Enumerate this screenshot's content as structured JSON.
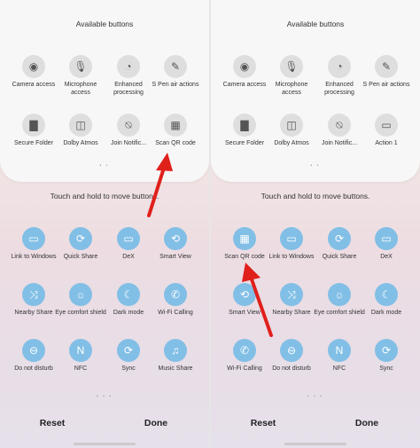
{
  "left": {
    "available_title": "Available buttons",
    "available": [
      {
        "label": "Camera access",
        "icon": "camera-icon",
        "glyph": "◉"
      },
      {
        "label": "Microphone access",
        "icon": "microphone-icon",
        "glyph": "🎙"
      },
      {
        "label": "Enhanced processing",
        "icon": "gauge-icon",
        "glyph": "◔"
      },
      {
        "label": "S Pen air actions",
        "icon": "pen-icon",
        "glyph": "✎"
      },
      {
        "label": "Secure Folder",
        "icon": "folder-icon",
        "glyph": "▇"
      },
      {
        "label": "Dolby Atmos",
        "icon": "dolby-icon",
        "glyph": "◫"
      },
      {
        "label": "Join Notific...",
        "icon": "notification-off-icon",
        "glyph": "⍉"
      },
      {
        "label": "Scan QR code",
        "icon": "qr-code-icon",
        "glyph": "▦"
      }
    ],
    "hint": "Touch and hold to move buttons.",
    "active": [
      {
        "label": "Link to Windows",
        "icon": "link-to-windows-icon",
        "glyph": "▭"
      },
      {
        "label": "Quick Share",
        "icon": "quick-share-icon",
        "glyph": "⟳"
      },
      {
        "label": "DeX",
        "icon": "dex-icon",
        "glyph": "▭"
      },
      {
        "label": "Smart View",
        "icon": "smart-view-icon",
        "glyph": "⟲"
      },
      {
        "label": "Nearby Share",
        "icon": "nearby-share-icon",
        "glyph": "⤨"
      },
      {
        "label": "Eye comfort shield",
        "icon": "eye-comfort-icon",
        "glyph": "☼"
      },
      {
        "label": "Dark mode",
        "icon": "moon-icon",
        "glyph": "☾"
      },
      {
        "label": "Wi-Fi Calling",
        "icon": "wifi-calling-icon",
        "glyph": "✆"
      },
      {
        "label": "Do not disturb",
        "icon": "do-not-disturb-icon",
        "glyph": "⊖"
      },
      {
        "label": "NFC",
        "icon": "nfc-icon",
        "glyph": "N"
      },
      {
        "label": "Sync",
        "icon": "sync-icon",
        "glyph": "⟳"
      },
      {
        "label": "Music Share",
        "icon": "music-share-icon",
        "glyph": "♫"
      }
    ],
    "dots_top": "• •",
    "dots_bottom": "• • •",
    "reset": "Reset",
    "done": "Done"
  },
  "right": {
    "available_title": "Available buttons",
    "available": [
      {
        "label": "Camera access",
        "icon": "camera-icon",
        "glyph": "◉"
      },
      {
        "label": "Microphone access",
        "icon": "microphone-icon",
        "glyph": "🎙"
      },
      {
        "label": "Enhanced processing",
        "icon": "gauge-icon",
        "glyph": "◔"
      },
      {
        "label": "S Pen air actions",
        "icon": "pen-icon",
        "glyph": "✎"
      },
      {
        "label": "Secure Folder",
        "icon": "folder-icon",
        "glyph": "▇"
      },
      {
        "label": "Dolby Atmos",
        "icon": "dolby-icon",
        "glyph": "◫"
      },
      {
        "label": "Join Notific...",
        "icon": "notification-off-icon",
        "glyph": "⍉"
      },
      {
        "label": "Action 1",
        "icon": "action-icon",
        "glyph": "▭"
      }
    ],
    "hint": "Touch and hold to move buttons.",
    "active": [
      {
        "label": "Scan QR code",
        "icon": "qr-code-icon",
        "glyph": "▦"
      },
      {
        "label": "Link to Windows",
        "icon": "link-to-windows-icon",
        "glyph": "▭"
      },
      {
        "label": "Quick Share",
        "icon": "quick-share-icon",
        "glyph": "⟳"
      },
      {
        "label": "DeX",
        "icon": "dex-icon",
        "glyph": "▭"
      },
      {
        "label": "Smart View",
        "icon": "smart-view-icon",
        "glyph": "⟲"
      },
      {
        "label": "Nearby Share",
        "icon": "nearby-share-icon",
        "glyph": "⤨"
      },
      {
        "label": "Eye comfort shield",
        "icon": "eye-comfort-icon",
        "glyph": "☼"
      },
      {
        "label": "Dark mode",
        "icon": "moon-icon",
        "glyph": "☾"
      },
      {
        "label": "Wi-Fi Calling",
        "icon": "wifi-calling-icon",
        "glyph": "✆"
      },
      {
        "label": "Do not disturb",
        "icon": "do-not-disturb-icon",
        "glyph": "⊖"
      },
      {
        "label": "NFC",
        "icon": "nfc-icon",
        "glyph": "N"
      },
      {
        "label": "Sync",
        "icon": "sync-icon",
        "glyph": "⟳"
      }
    ],
    "dots_top": "• •",
    "dots_bottom": "• • •",
    "reset": "Reset",
    "done": "Done"
  },
  "colors": {
    "accent_blue": "#82bfe6",
    "inactive_grey": "#dedede",
    "annotation_arrow": "#e0201b"
  }
}
